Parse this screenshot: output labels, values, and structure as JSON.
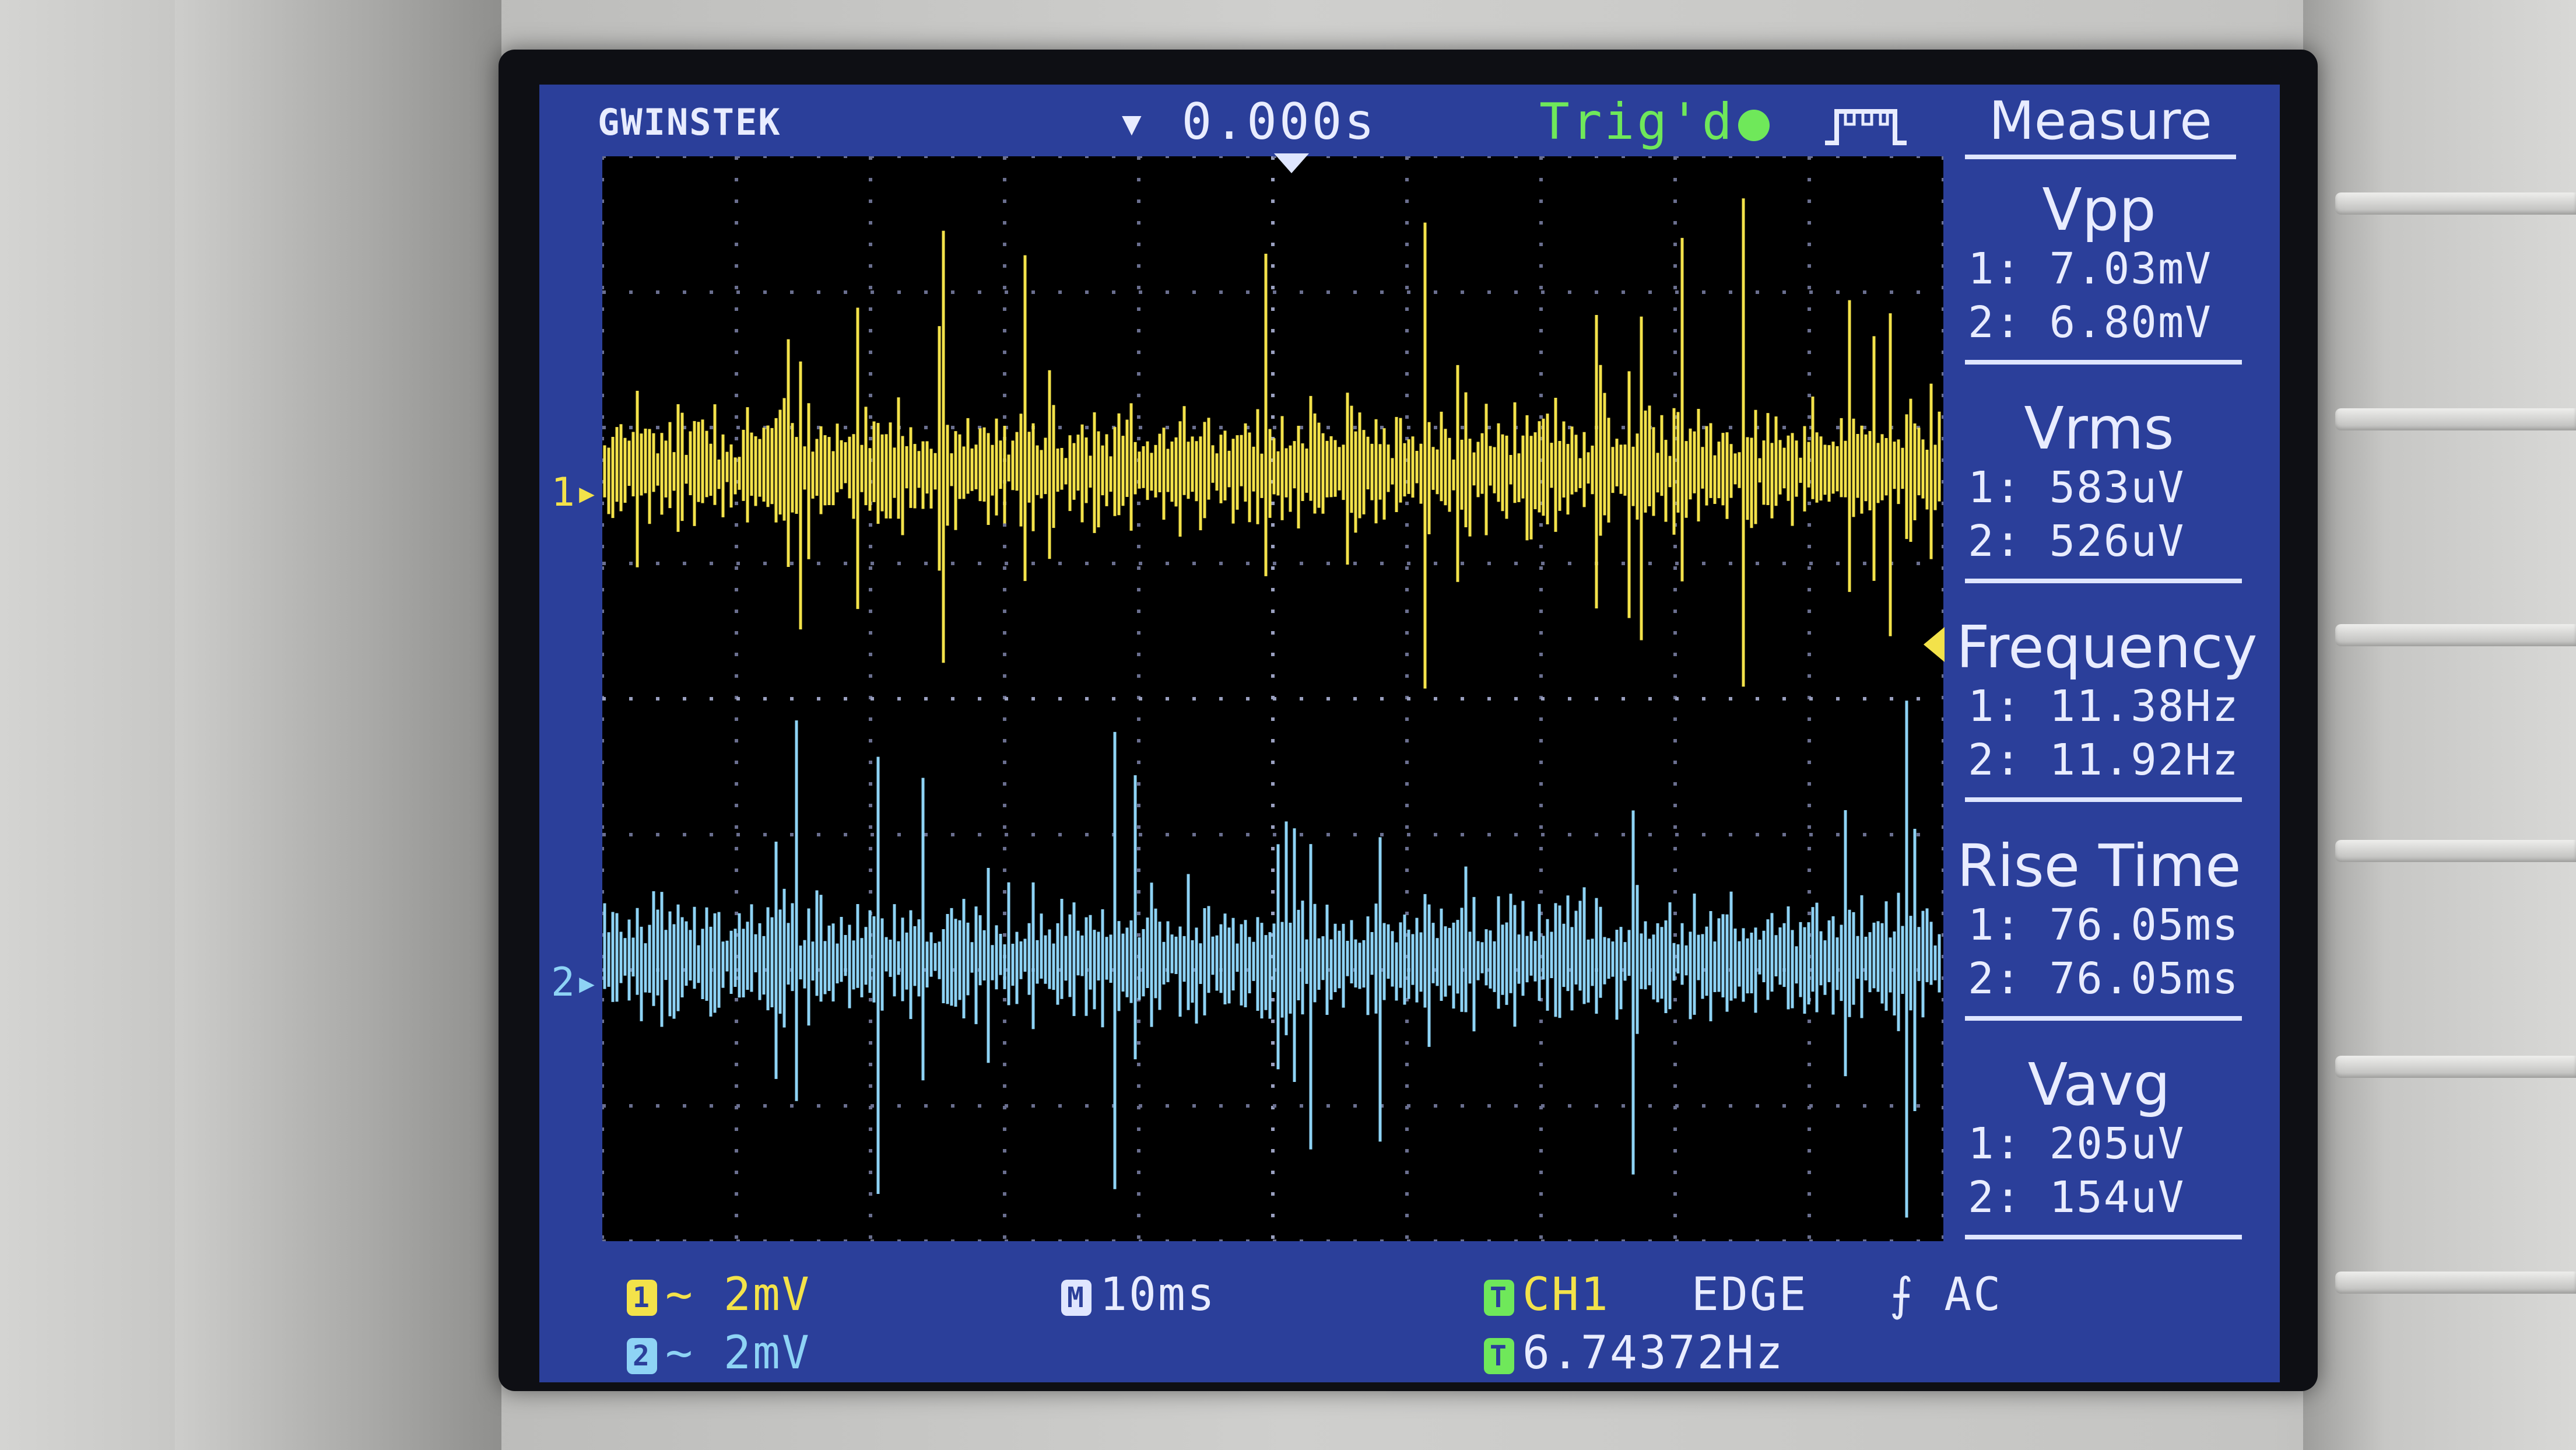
{
  "header": {
    "brand": "GWINSTEK",
    "time_position": "▾ 0.000s",
    "trigger_status": "Trig'd"
  },
  "menu": {
    "title": "Measure"
  },
  "measurements": [
    {
      "name": "Vpp",
      "ch1": "1: 7.03mV",
      "ch2": "2: 6.80mV"
    },
    {
      "name": "Vrms",
      "ch1": "1: 583uV",
      "ch2": "2: 526uV"
    },
    {
      "name": "Frequency",
      "ch1": "1: 11.38Hz",
      "ch2": "2: 11.92Hz"
    },
    {
      "name": "Rise Time",
      "ch1": "1: 76.05ms",
      "ch2": "2: 76.05ms"
    },
    {
      "name": "Vavg",
      "ch1": "1: 205uV",
      "ch2": "2: 154uV"
    }
  ],
  "channels": [
    {
      "marker": "1▸",
      "badge": "1",
      "scale": "~ 2mV",
      "color": "#f3e24a"
    },
    {
      "marker": "2▸",
      "badge": "2",
      "scale": "~ 2mV",
      "color": "#8ed3f5"
    }
  ],
  "timebase": {
    "badge": "M",
    "value": "10ms"
  },
  "trigger": {
    "badge": "T",
    "source": "CH1",
    "type": "EDGE",
    "coupling": "⨍ AC",
    "freq_badge": "T",
    "frequency": "6.74372Hz"
  },
  "colors": {
    "screen_bg": "#2b3f9a",
    "grid_bg": "#000000",
    "ch1": "#f3e24a",
    "ch2": "#8ed3f5",
    "trigger_green": "#6fe85a"
  }
}
